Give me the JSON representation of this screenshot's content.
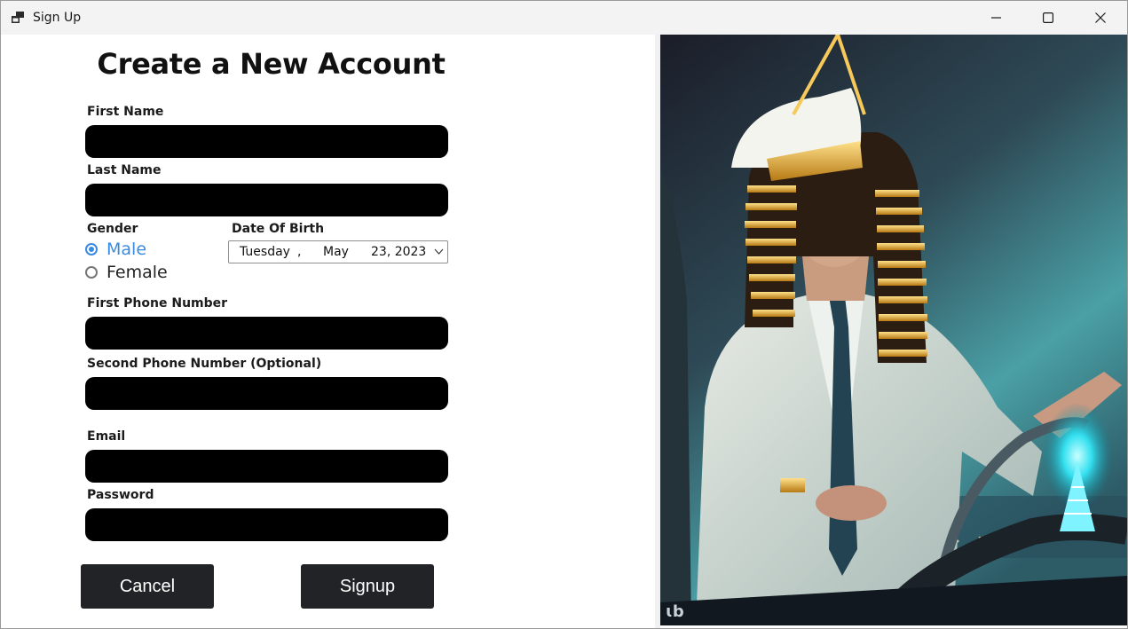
{
  "window": {
    "title": "Sign Up",
    "app_icon": "app-window-icon",
    "controls": [
      "minimize-icon",
      "maximize-icon",
      "close-icon"
    ]
  },
  "form": {
    "heading": "Create a New Account",
    "first_name_label": "First Name",
    "last_name_label": "Last Name",
    "gender_label": "Gender",
    "gender_options": [
      "Male",
      "Female"
    ],
    "gender_selected": "Male",
    "dob_label": "Date Of Birth",
    "dob": {
      "weekday": "Tuesday",
      "separator": ",",
      "month": "May",
      "day_year": "23, 2023"
    },
    "first_phone_label": "First Phone Number",
    "second_phone_label": "Second Phone Number (Optional)",
    "email_label": "Email",
    "password_label": "Password",
    "cancel_label": "Cancel",
    "signup_label": "Signup"
  },
  "colors": {
    "accent": "#3a8be0",
    "field_bg": "#000000",
    "button_bg": "#222326",
    "titlebar_bg": "#f3f3f3"
  },
  "image": {
    "subject": "man-in-white-suit-with-pharaoh-headdress-at-ship-wheel",
    "watermark": "b"
  }
}
